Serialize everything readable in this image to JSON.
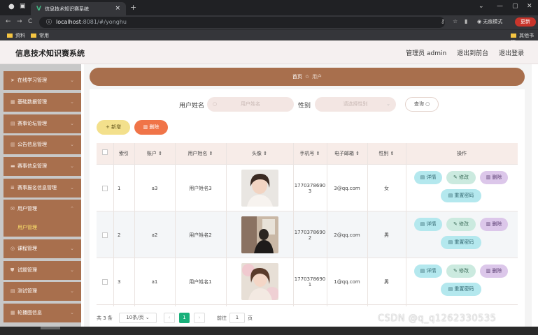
{
  "browser": {
    "tab_title": "信息技术知识赛系统",
    "url_host": "localhost",
    "url_rest": ":8081/#/yonghu",
    "incognito_label": "无痕模式",
    "update_label": "更新",
    "bookmarks": [
      "资料",
      "常用"
    ],
    "bookmarks_right": "其他书签"
  },
  "header": {
    "title": "信息技术知识赛系统",
    "user": "管理员 admin",
    "front_link": "退出到前台",
    "logout_link": "退出登录"
  },
  "sidebar": {
    "items": [
      {
        "label": "在线学习管理",
        "icon": "send-icon"
      },
      {
        "label": "基础数据管理",
        "icon": "grid-icon"
      },
      {
        "label": "赛事论坛管理",
        "icon": "chat-icon"
      },
      {
        "label": "公告信息管理",
        "icon": "bar-chart-icon"
      },
      {
        "label": "赛事信息管理",
        "icon": "card-icon"
      },
      {
        "label": "赛事报名信息管理",
        "icon": "list-icon"
      },
      {
        "label": "用户管理",
        "icon": "mail-icon"
      },
      {
        "label": "课程管理",
        "icon": "circle-icon"
      },
      {
        "label": "试题管理",
        "icon": "shield-icon"
      },
      {
        "label": "测试管理",
        "icon": "doc-icon"
      },
      {
        "label": "轮播图信息",
        "icon": "grid-icon"
      }
    ],
    "active_sub": "用户管理"
  },
  "breadcrumb": {
    "home": "首页",
    "current": "用户"
  },
  "filters": {
    "name_label": "用户姓名",
    "name_placeholder": "用户姓名",
    "gender_label": "性别",
    "gender_placeholder": "请选择性别",
    "query_label": "查询"
  },
  "actions": {
    "add": "+ 新增",
    "delete": "删除"
  },
  "table": {
    "headers": [
      "索引",
      "账户",
      "用户姓名",
      "头像",
      "手机号",
      "电子邮箱",
      "性别",
      "操作"
    ],
    "rows": [
      {
        "index": "1",
        "account": "a3",
        "name": "用户姓名3",
        "phone1": "1770378690",
        "phone2": "3",
        "email": "3@qq.com",
        "gender": "女"
      },
      {
        "index": "2",
        "account": "a2",
        "name": "用户姓名2",
        "phone1": "1770378690",
        "phone2": "2",
        "email": "2@qq.com",
        "gender": "男"
      },
      {
        "index": "3",
        "account": "a1",
        "name": "用户姓名1",
        "phone1": "1770378690",
        "phone2": "1",
        "email": "1@qq.com",
        "gender": "男"
      }
    ],
    "btn_detail": "详情",
    "btn_edit": "修改",
    "btn_delete": "删除",
    "btn_reset": "重置密码"
  },
  "pager": {
    "total": "共 3 条",
    "page_size": "10条/页",
    "current": "1",
    "goto_label": "前往",
    "goto_value": "1",
    "page_unit": "页"
  },
  "watermark": "CSDN @q_q1262330535"
}
